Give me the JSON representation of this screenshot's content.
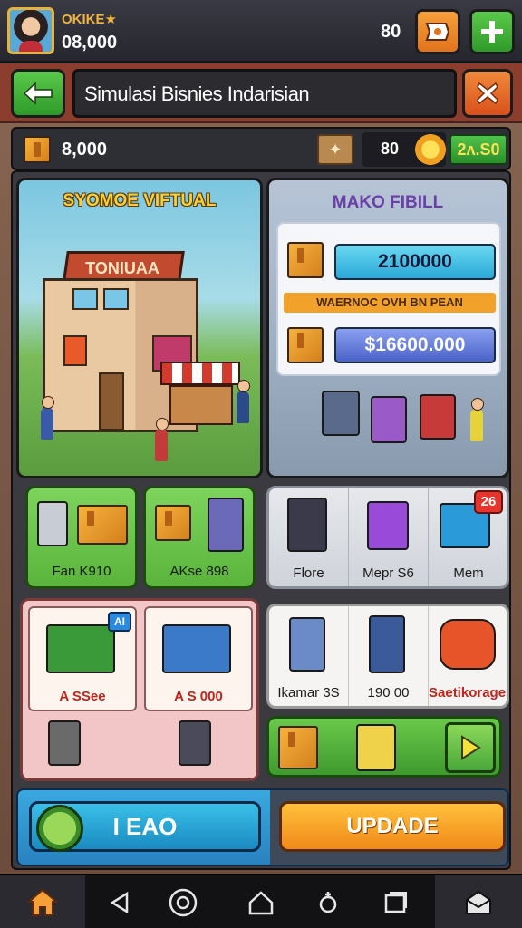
{
  "player": {
    "name": "OKIKE★",
    "coins": "08,000"
  },
  "top": {
    "count": "80"
  },
  "header": {
    "title": "Simulasi Bisnies Indarisian"
  },
  "resources": {
    "coins": "8,000",
    "count": "80",
    "premium": "2ʌ.S0"
  },
  "store": {
    "title": "SYOMOE VIFTUAL",
    "sign": "TONIUAA"
  },
  "modal": {
    "title": "MAKO FIBILL",
    "value_top": "2100000",
    "warning": "WAERNOC OVH BN PEAN",
    "value_bottom": "$16600.000"
  },
  "row2": {
    "green": [
      {
        "label": "Fan K910"
      },
      {
        "label": "AKse 898"
      }
    ],
    "grey": [
      {
        "label": "Flore"
      },
      {
        "label": "Mepr S6"
      },
      {
        "label": "Mem"
      }
    ],
    "badge": "26"
  },
  "row3": {
    "pink": [
      {
        "label": "A SSee",
        "badge": "AI"
      },
      {
        "label": "A S 000"
      }
    ],
    "white": [
      {
        "label": "Ikamar 3S"
      },
      {
        "label": "190 00"
      },
      {
        "label": "Saetikorages"
      }
    ]
  },
  "actions": {
    "left_label": "I EAO",
    "upgrade_label": "UPDADE"
  },
  "colors": {
    "accent": "#f7a03a",
    "primary_green": "#4fc34a",
    "danger": "#e8342a",
    "sky": "#3ac0e8"
  }
}
